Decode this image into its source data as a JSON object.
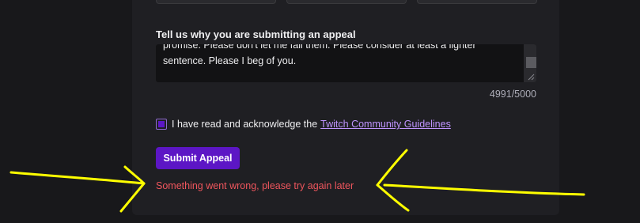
{
  "form": {
    "label": "Tell us why you are submitting an appeal",
    "textarea_line_partial": "promise. Please don't let me fail them. Please consider at least a lighter",
    "textarea_line_last": "sentence. Please I beg of you.",
    "char_count": "4991/5000",
    "ack_text": "I have read and acknowledge the",
    "ack_link": "Twitch Community Guidelines",
    "ack_checked": true,
    "submit_label": "Submit Appeal",
    "error_message": "Something went wrong, please try again later"
  },
  "colors": {
    "background": "#18181b",
    "card": "#1f1f23",
    "accent": "#5c16c5",
    "link": "#bf94ff",
    "error": "#f0565d",
    "annotation": "#ffff00"
  }
}
